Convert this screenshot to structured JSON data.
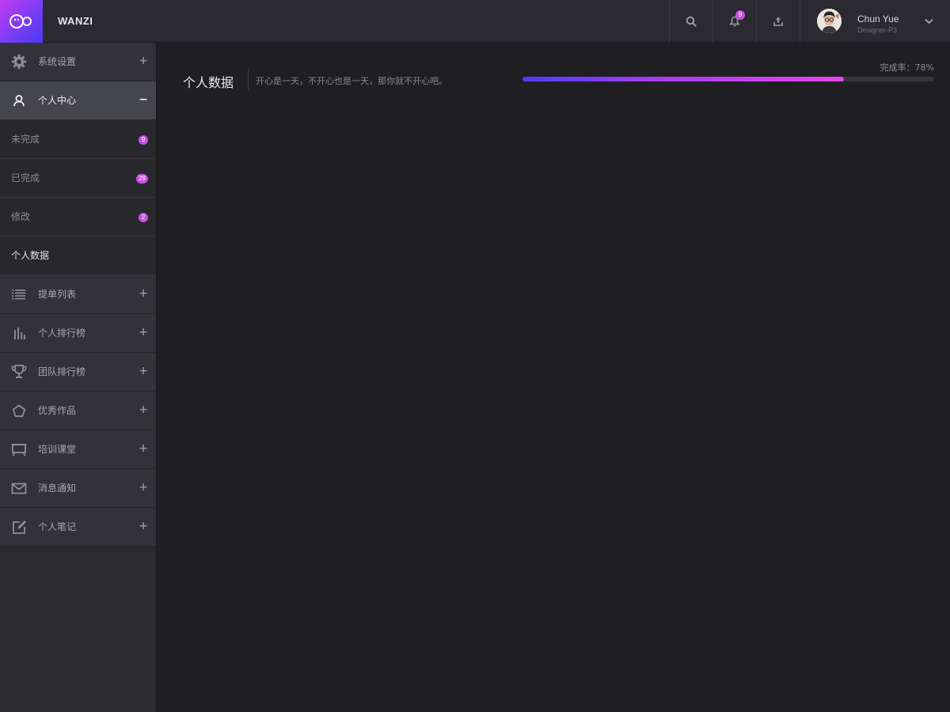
{
  "header": {
    "brand": "WANZI",
    "notification_count": "9",
    "user": {
      "name": "Chun Yue",
      "role": "Designer-P3"
    },
    "icons": [
      "logo-icon",
      "search-icon",
      "bell-icon",
      "upload-icon",
      "chevron-down-icon"
    ]
  },
  "sidebar": {
    "items": [
      {
        "label": "系统设置",
        "icon": "gear-icon",
        "toggle": "+"
      },
      {
        "label": "个人中心",
        "icon": "user-icon",
        "toggle": "−"
      },
      {
        "label": "提单列表",
        "icon": "list-icon",
        "toggle": "+"
      },
      {
        "label": "个人排行榜",
        "icon": "bar-chart-icon",
        "toggle": "+"
      },
      {
        "label": "团队排行榜",
        "icon": "trophy-icon",
        "toggle": "+"
      },
      {
        "label": "优秀作品",
        "icon": "star-icon",
        "toggle": "+"
      },
      {
        "label": "培训课堂",
        "icon": "easel-icon",
        "toggle": "+"
      },
      {
        "label": "消息通知",
        "icon": "mail-icon",
        "toggle": "+"
      },
      {
        "label": "个人笔记",
        "icon": "edit-icon",
        "toggle": "+"
      }
    ],
    "subitems": [
      {
        "label": "未完成",
        "badge": "9"
      },
      {
        "label": "已完成",
        "badge": "29"
      },
      {
        "label": "修改",
        "badge": "2"
      },
      {
        "label": "个人数据"
      }
    ]
  },
  "main": {
    "title": "个人数据",
    "subtitle": "开心是一天，不开心也是一天，那你就不开心吧。",
    "progress_label": "完成率：78%",
    "progress_value": 0.78
  },
  "colors": {
    "accent": "#c94ee6",
    "gradient_start": "#4a3ef5",
    "gradient_end": "#e447e6",
    "background": "#1f1e23",
    "sidebar": "#2a2a2f"
  }
}
